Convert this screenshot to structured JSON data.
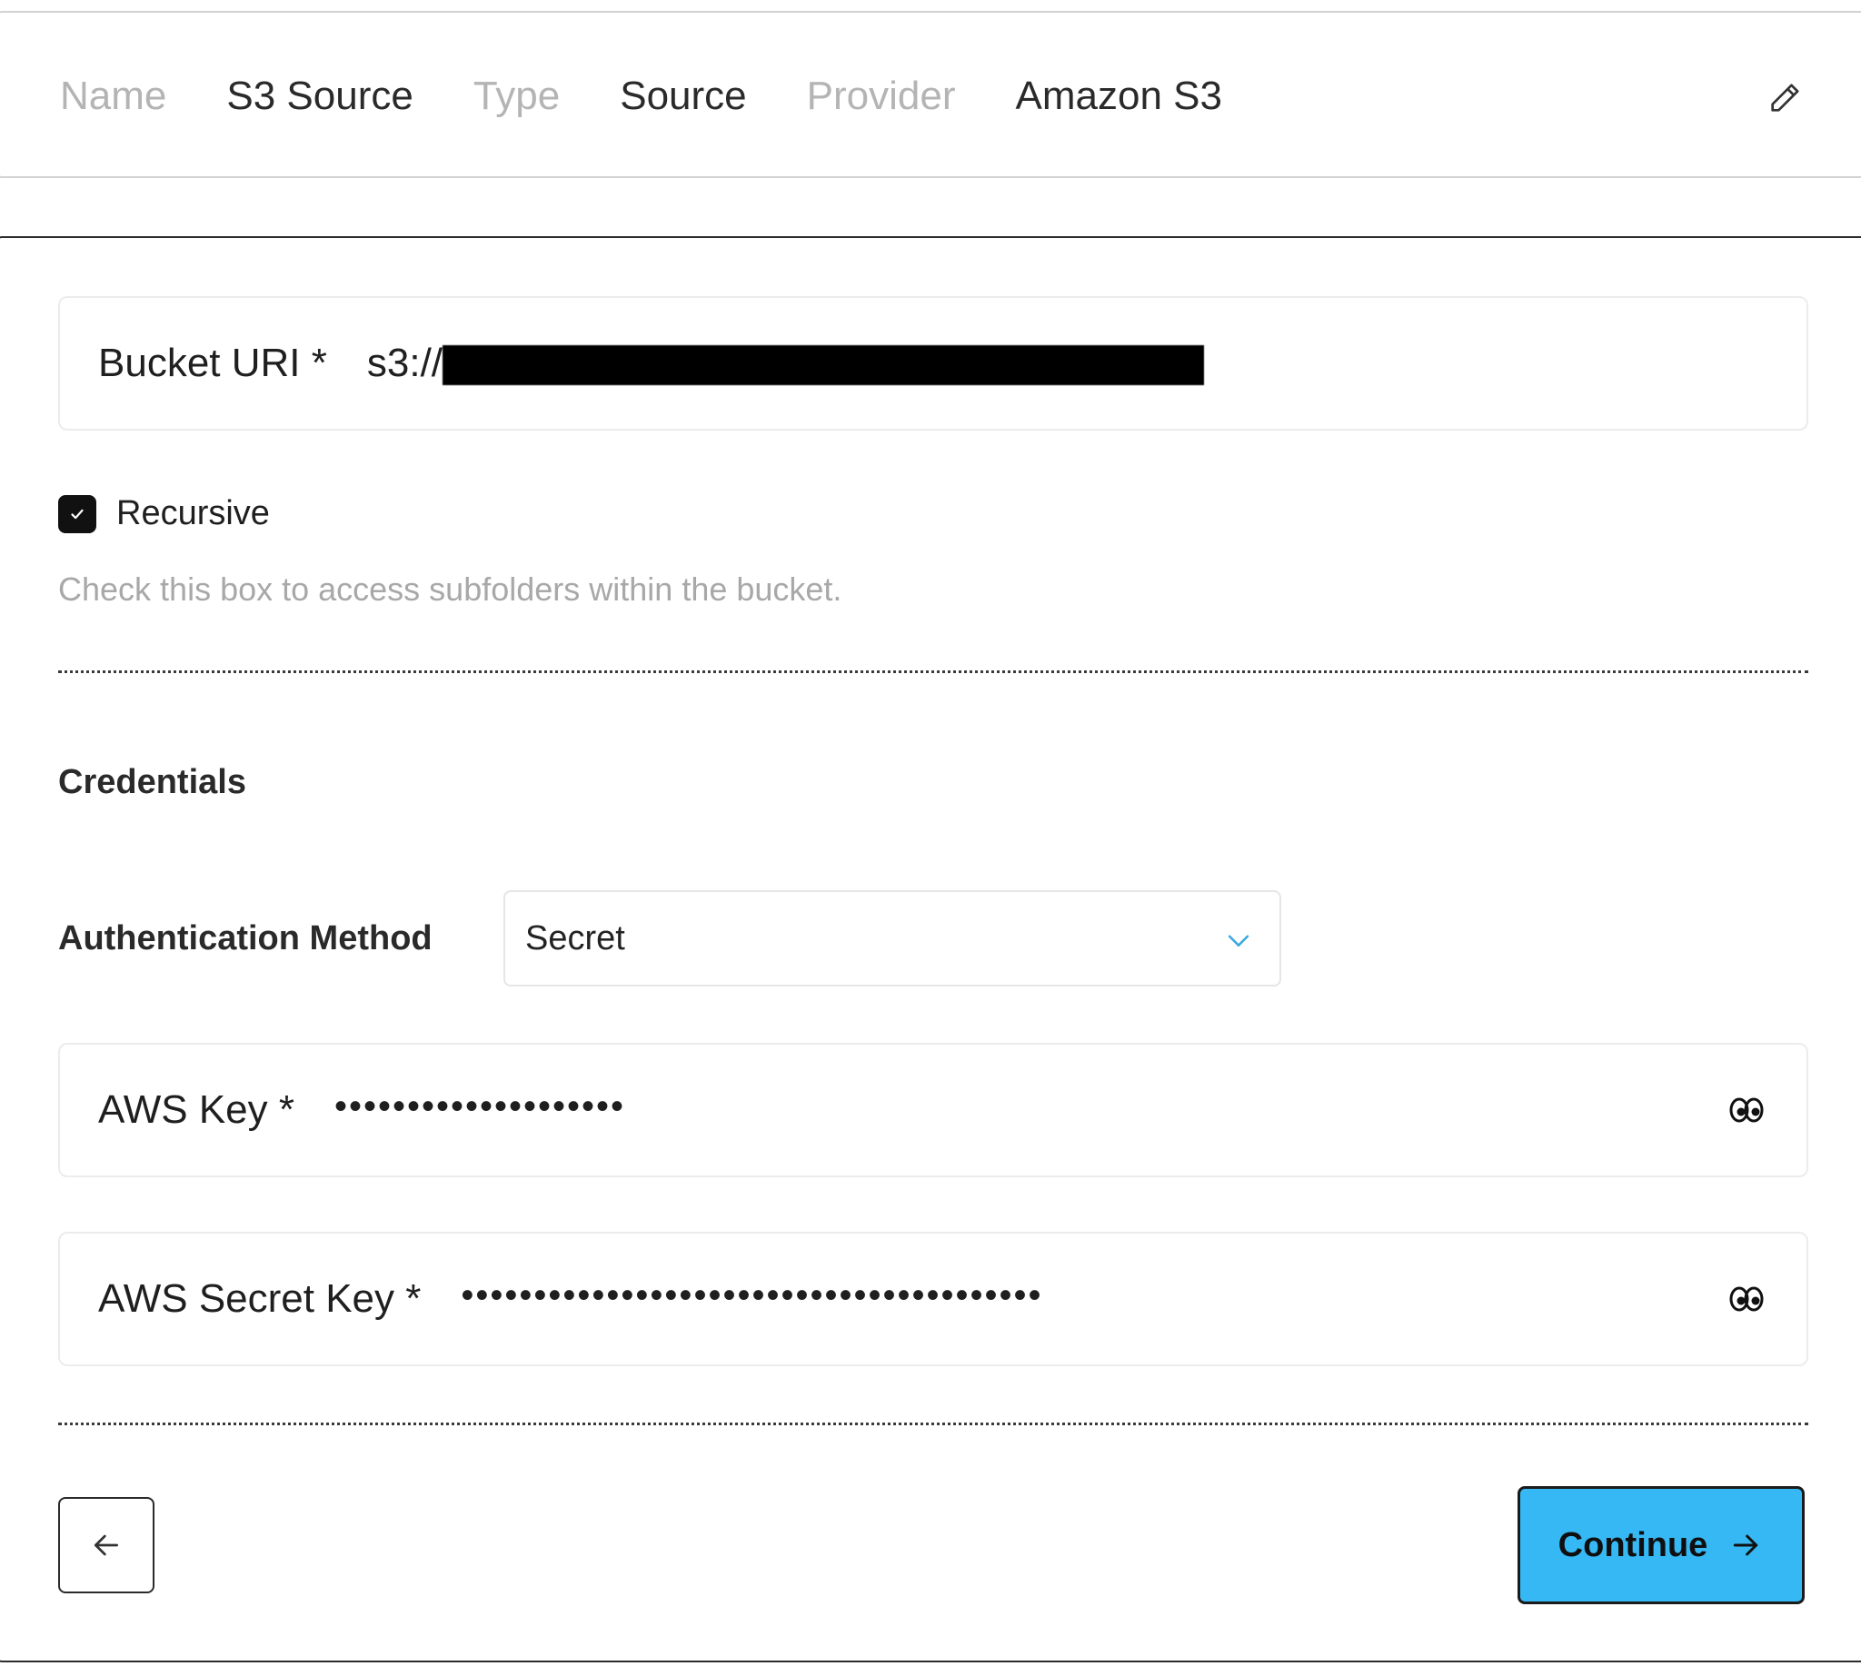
{
  "summary": {
    "name_label": "Name",
    "name_value": "S3 Source",
    "type_label": "Type",
    "type_value": "Source",
    "provider_label": "Provider",
    "provider_value": "Amazon S3",
    "edit_icon": "pencil-icon"
  },
  "bucket": {
    "label": "Bucket URI *",
    "value_prefix": "s3://"
  },
  "recursive": {
    "label": "Recursive",
    "checked": true,
    "help": "Check this box to access subfolders within the bucket."
  },
  "credentials": {
    "title": "Credentials",
    "auth_label": "Authentication Method",
    "auth_value": "Secret",
    "aws_key_label": "AWS Key *",
    "aws_key_value": "••••••••••••••••••••",
    "aws_secret_label": "AWS Secret Key *",
    "aws_secret_value": "••••••••••••••••••••••••••••••••••••••••",
    "reveal_icon": "eye-icon"
  },
  "actions": {
    "back_icon": "arrow-left-icon",
    "continue_label": "Continue",
    "continue_icon": "arrow-right-icon",
    "accent_color": "#36b8f4"
  }
}
